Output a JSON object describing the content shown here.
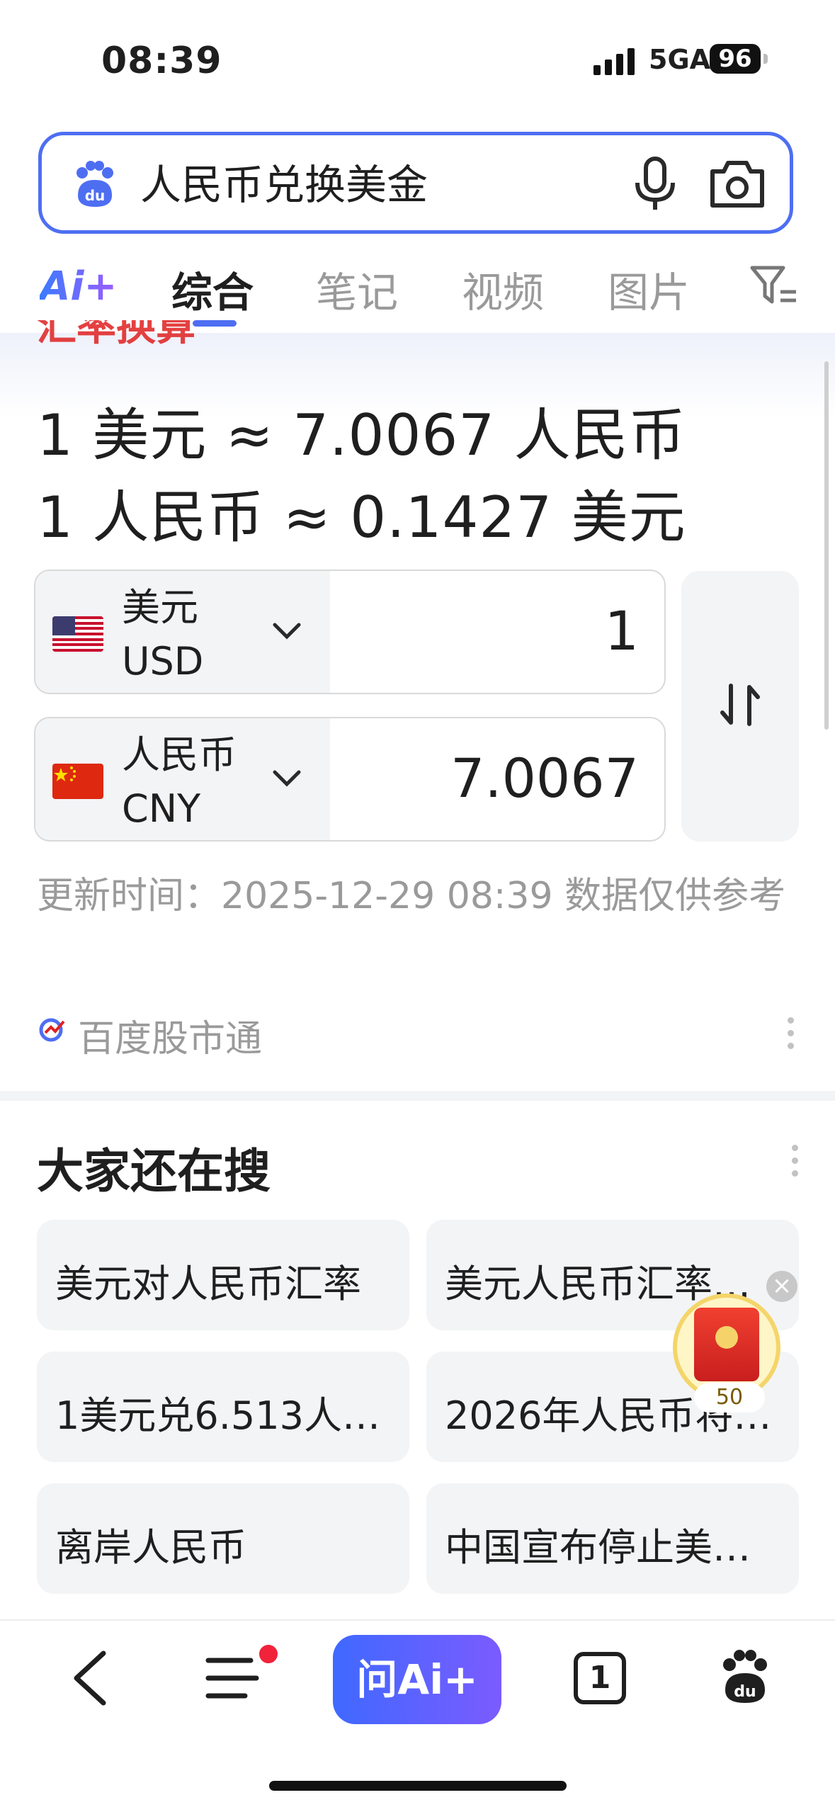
{
  "status_bar": {
    "time": "08:39",
    "network": "5GA",
    "battery": "96"
  },
  "search": {
    "query": "人民币兑换美金"
  },
  "tabs": {
    "ai_label": "Ai+",
    "items": [
      "综合",
      "笔记",
      "视频",
      "图片"
    ],
    "active_index": 0
  },
  "exchange_card": {
    "partial_title": "汇率换算",
    "rate_line_1": "1 美元 ≈ 7.0067 人民币",
    "rate_line_2": "1 人民币 ≈ 0.1427 美元",
    "from": {
      "name": "美元",
      "code": "USD",
      "amount": "1"
    },
    "to": {
      "name": "人民币",
      "code": "CNY",
      "amount": "7.0067"
    },
    "update_text": "更新时间：2025-12-29 08:39 数据仅供参考",
    "source": "百度股市通"
  },
  "related": {
    "title": "大家还在搜",
    "items": [
      "美元对人民币汇率",
      "美元人民币汇率…",
      "1美元兑6.513人…",
      "2026年人民币将…",
      "离岸人民币",
      "中国宣布停止美…"
    ]
  },
  "floating": {
    "count": "50"
  },
  "bottom_bar": {
    "ai_button": "问Ai+",
    "tab_count": "1"
  },
  "colors": {
    "accent": "#4e6ef2",
    "red": "#f0233b"
  }
}
